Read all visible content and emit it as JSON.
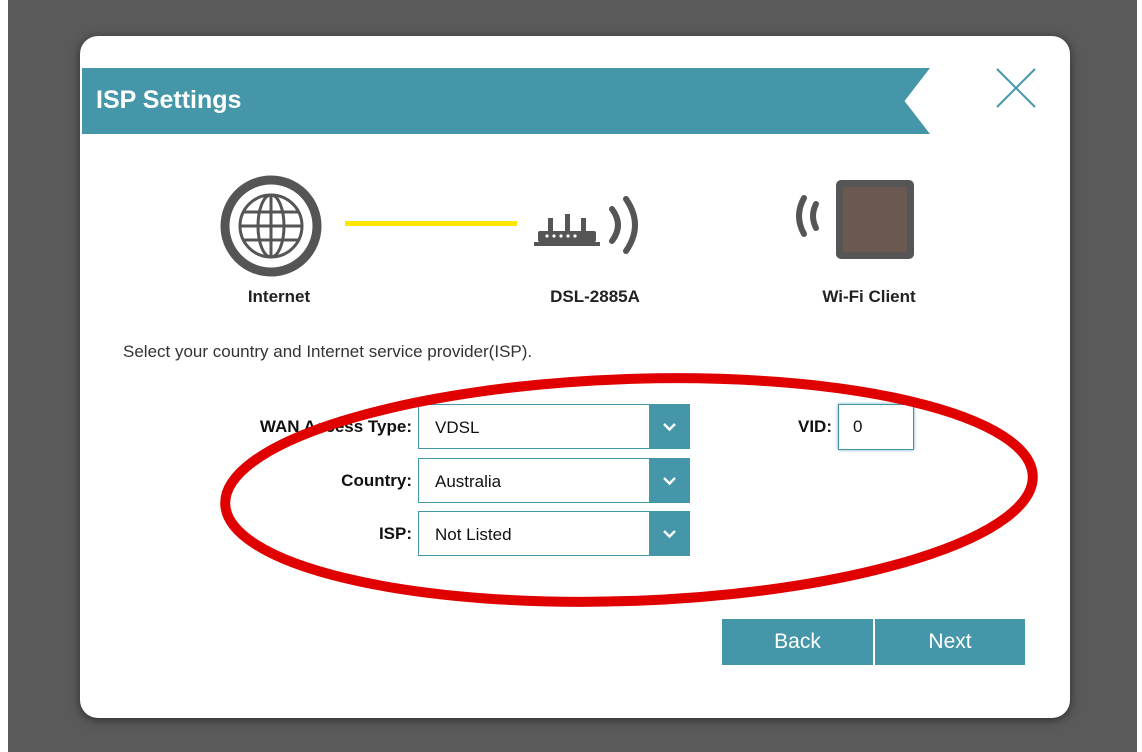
{
  "dialog": {
    "title": "ISP Settings",
    "close_icon": "close-x-icon"
  },
  "diagram": {
    "internet": {
      "label": "Internet",
      "icon": "globe-icon"
    },
    "router": {
      "label": "DSL-2885A",
      "icon": "router-icon"
    },
    "client": {
      "label": "Wi-Fi Client",
      "icon": "tablet-icon"
    }
  },
  "instructions": "Select your country and Internet service provider(ISP).",
  "form": {
    "wan_access_type": {
      "label": "WAN Access Type:",
      "value": "VDSL"
    },
    "country": {
      "label": "Country:",
      "value": "Australia"
    },
    "isp": {
      "label": "ISP:",
      "value": "Not Listed"
    },
    "vid": {
      "label": "VID:",
      "value": "0"
    }
  },
  "buttons": {
    "back": "Back",
    "next": "Next"
  },
  "colors": {
    "accent": "#4596a8",
    "connection_line": "#ffe600",
    "annotation": "#e00000",
    "backdrop": "#5a5a5a"
  }
}
